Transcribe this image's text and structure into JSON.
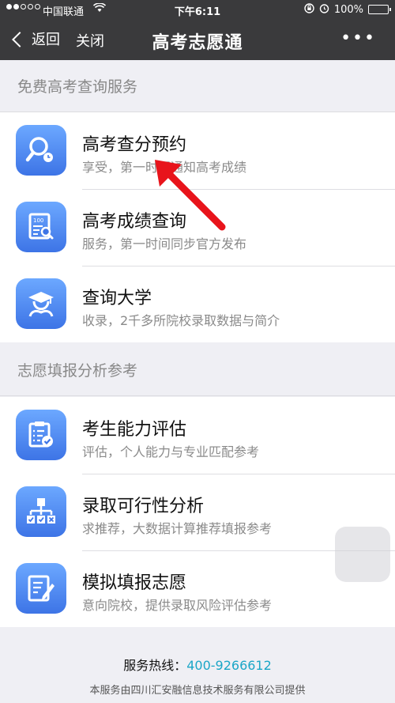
{
  "status": {
    "carrier": "中国联通",
    "time": "下午6:11",
    "battery": "100%"
  },
  "nav": {
    "back_label": "返回",
    "close_label": "关闭",
    "title": "高考志愿通",
    "more": "•••"
  },
  "section1": {
    "header": "免费高考查询服务",
    "items": [
      {
        "title": "高考查分预约",
        "subtitle": "享受，第一时间通知高考成绩",
        "icon": "search-clock-icon"
      },
      {
        "title": "高考成绩查询",
        "subtitle": "服务，第一时间同步官方发布",
        "icon": "score-doc-icon"
      },
      {
        "title": "查询大学",
        "subtitle": "收录，2千多所院校录取数据与简介",
        "icon": "graduate-icon"
      }
    ]
  },
  "section2": {
    "header": "志愿填报分析参考",
    "items": [
      {
        "title": "考生能力评估",
        "subtitle": "评估，个人能力与专业匹配参考",
        "icon": "checklist-icon"
      },
      {
        "title": "录取可行性分析",
        "subtitle": "求推荐，大数据计算推荐填报参考",
        "icon": "tree-chart-icon"
      },
      {
        "title": "模拟填报志愿",
        "subtitle": "意向院校，提供录取风险评估参考",
        "icon": "form-pen-icon"
      }
    ]
  },
  "footer": {
    "hotline_label": "服务热线：",
    "hotline_number": "400-9266612",
    "provider": "本服务由四川汇安融信息技术服务有限公司提供"
  },
  "colors": {
    "topbar": "#3a3a3c",
    "icon_blue": "#3d74e6",
    "hotline": "#1ba6c7",
    "arrow": "#e8141b"
  }
}
